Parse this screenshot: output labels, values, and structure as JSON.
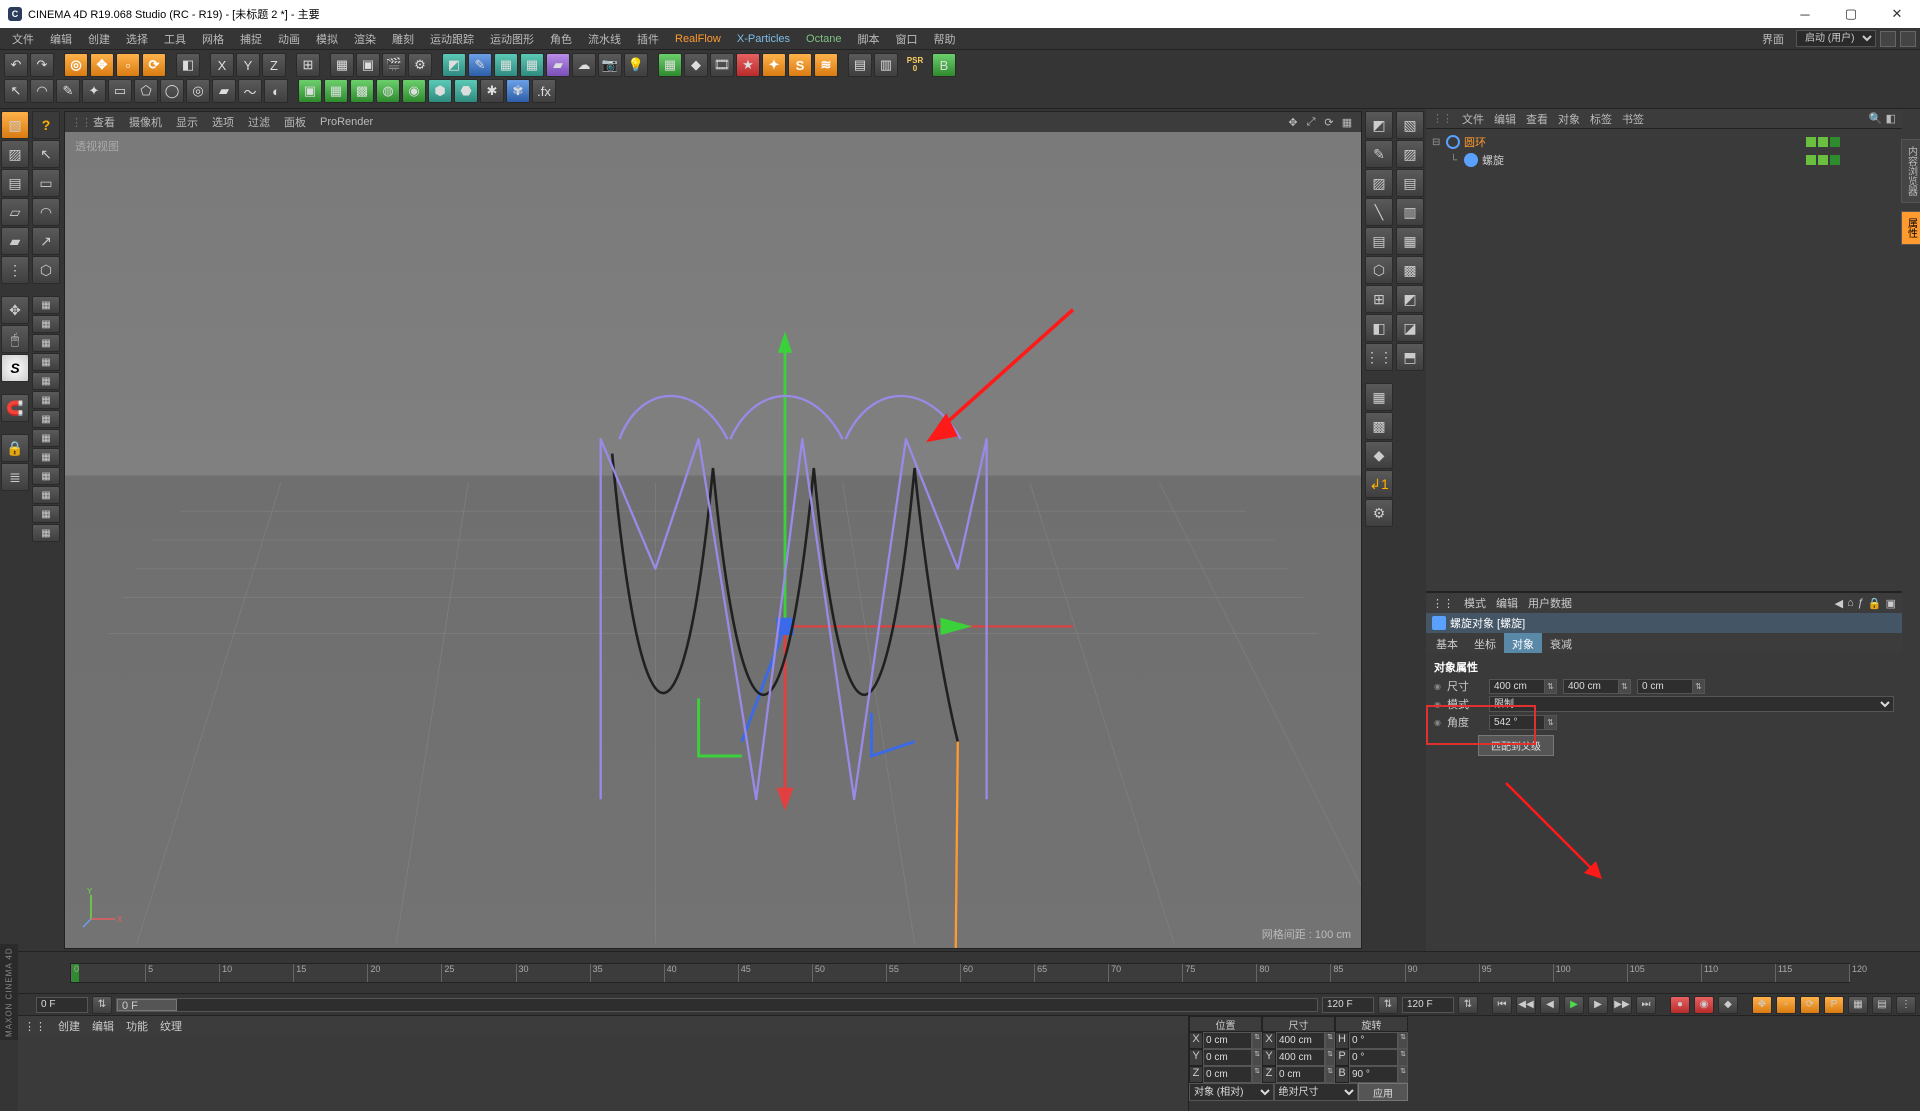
{
  "title": "CINEMA 4D R19.068 Studio (RC - R19) - [未标题 2 *] - 主要",
  "menubar": [
    "文件",
    "编辑",
    "创建",
    "选择",
    "工具",
    "网格",
    "捕捉",
    "动画",
    "模拟",
    "渲染",
    "雕刻",
    "运动跟踪",
    "运动图形",
    "角色",
    "流水线",
    "插件",
    "RealFlow",
    "X-Particles",
    "Octane",
    "脚本",
    "窗口",
    "帮助"
  ],
  "layout_label": "界面",
  "layout_value": "启动 (用户)",
  "viewport": {
    "menu": [
      "查看",
      "摄像机",
      "显示",
      "选项",
      "过滤",
      "面板",
      "ProRender"
    ],
    "label": "透视视图",
    "info": "网格间距 : 100 cm"
  },
  "objects": {
    "menu": [
      "文件",
      "编辑",
      "查看",
      "对象",
      "标签",
      "书签"
    ],
    "items": [
      {
        "name": "圆环",
        "sel": true,
        "icon": "ring",
        "indent": 0,
        "tog": "⊟"
      },
      {
        "name": "螺旋",
        "sel": false,
        "icon": "helix",
        "indent": 1,
        "tog": "└"
      }
    ]
  },
  "attributes": {
    "head": [
      "模式",
      "编辑",
      "用户数据"
    ],
    "title": "螺旋对象 [螺旋]",
    "tabs": [
      "基本",
      "坐标",
      "对象",
      "衰减"
    ],
    "active_tab": "对象",
    "section": "对象属性",
    "size": {
      "label": "尺寸",
      "x": "400 cm",
      "y": "400 cm",
      "z": "0 cm"
    },
    "mode": {
      "label": "模式",
      "value": "限制"
    },
    "angle": {
      "label": "角度",
      "value": "542 °"
    },
    "fit_btn": "匹配到父级"
  },
  "timeline": {
    "marks": [
      "0",
      "5",
      "10",
      "15",
      "20",
      "25",
      "30",
      "35",
      "40",
      "45",
      "50",
      "55",
      "60",
      "65",
      "70",
      "75",
      "80",
      "85",
      "90",
      "95",
      "100",
      "105",
      "110",
      "115",
      "120"
    ],
    "start": "0 F",
    "cur": "0 F",
    "end": "120 F",
    "end2": "120 F"
  },
  "materials": {
    "menu": [
      "创建",
      "编辑",
      "功能",
      "纹理"
    ]
  },
  "coords": {
    "headers": [
      "位置",
      "尺寸",
      "旋转"
    ],
    "rows": [
      {
        "ax": "X",
        "p": "0 cm",
        "s": "400 cm",
        "r": "0 °",
        "rl": "H"
      },
      {
        "ax": "Y",
        "p": "0 cm",
        "s": "400 cm",
        "r": "0 °",
        "rl": "P"
      },
      {
        "ax": "Z",
        "p": "0 cm",
        "s": "0 cm",
        "r": "90 °",
        "rl": "B"
      }
    ],
    "sel1": "对象 (相对)",
    "sel2": "绝对尺寸",
    "apply": "应用"
  },
  "psr": "PSR",
  "brand": "MAXON CINEMA 4D"
}
